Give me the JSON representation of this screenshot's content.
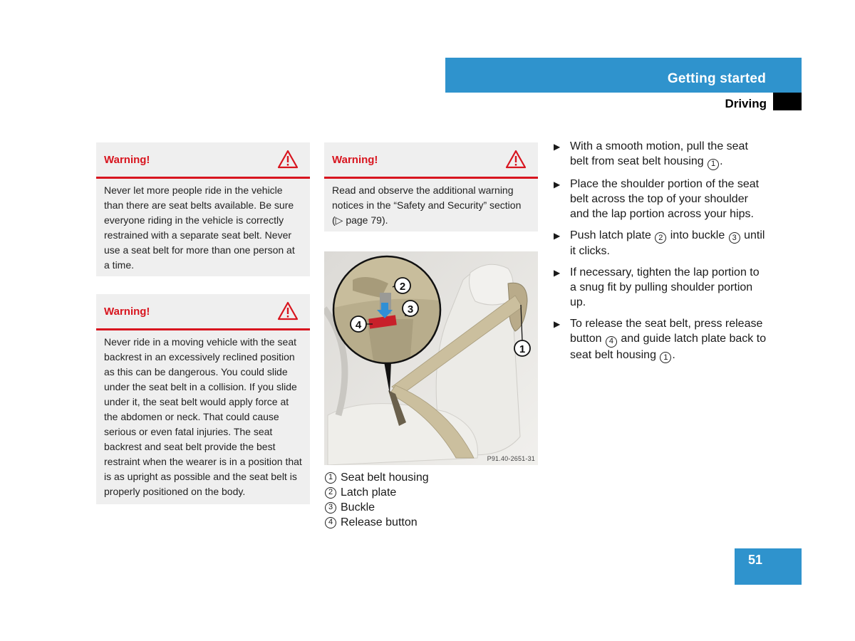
{
  "header": {
    "section_title": "Getting started",
    "subsection_title": "Driving",
    "accent_color": "#2f93cd"
  },
  "warnings": [
    {
      "title": "Warning!",
      "icon": "warning-triangle-icon",
      "body": "Never let more people ride in the vehicle than there are seat belts available. Be sure everyone riding in the vehicle is correctly restrained with a separate seat belt. Never use a seat belt for more than one person at a time."
    },
    {
      "title": "Warning!",
      "icon": "warning-triangle-icon",
      "body": "Never ride in a moving vehicle with the seat backrest in an excessively reclined position as this can be dangerous. You could slide under the seat belt in a collision. If you slide under it, the seat belt would apply force at the abdomen or neck. That could cause serious or even fatal injuries. The seat backrest and seat belt provide the best restraint when the wearer is in a position that is as upright as possible and the seat belt is properly positioned on the body."
    },
    {
      "title": "Warning!",
      "icon": "warning-triangle-icon",
      "body_before": "Read and observe the additional warning notices in the “Safety and Security” section (",
      "page_ref": "▷ page 79",
      "body_after": ")."
    }
  ],
  "warning_color": "#d8151f",
  "figure": {
    "code": "P91.40-2651-31",
    "callouts": [
      "1",
      "2",
      "3",
      "4"
    ]
  },
  "legend": [
    {
      "num": "1",
      "label": "Seat belt housing"
    },
    {
      "num": "2",
      "label": "Latch plate"
    },
    {
      "num": "3",
      "label": "Buckle"
    },
    {
      "num": "4",
      "label": "Release button"
    }
  ],
  "steps": [
    {
      "parts": [
        {
          "t": "With a smooth motion, pull the seat belt from seat belt housing "
        },
        {
          "n": "1"
        },
        {
          "t": "."
        }
      ]
    },
    {
      "parts": [
        {
          "t": "Place the shoulder portion of the seat belt across the top of your shoulder and the lap portion across your hips."
        }
      ]
    },
    {
      "parts": [
        {
          "t": "Push latch plate "
        },
        {
          "n": "2"
        },
        {
          "t": " into buckle "
        },
        {
          "n": "3"
        },
        {
          "t": " until it clicks."
        }
      ]
    },
    {
      "parts": [
        {
          "t": "If necessary, tighten the lap portion to a snug fit by pulling shoulder portion up."
        }
      ]
    },
    {
      "parts": [
        {
          "t": "To release the seat belt, press release button "
        },
        {
          "n": "4"
        },
        {
          "t": " and guide latch plate back to seat belt housing "
        },
        {
          "n": "1"
        },
        {
          "t": "."
        }
      ]
    }
  ],
  "step_bullet": "▶",
  "page_number": "51"
}
